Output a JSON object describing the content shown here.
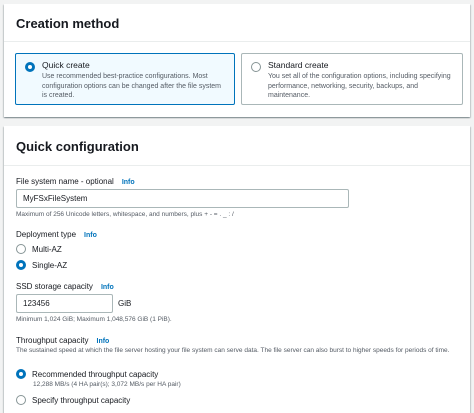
{
  "creation": {
    "title": "Creation method",
    "quick": {
      "label": "Quick create",
      "desc": "Use recommended best-practice configurations. Most configuration options can be changed after the file system is created."
    },
    "standard": {
      "label": "Standard create",
      "desc": "You set all of the configuration options, including specifying performance, networking, security, backups, and maintenance."
    }
  },
  "quick_config": {
    "title": "Quick configuration",
    "info": "Info",
    "fs_name": {
      "label": "File system name - optional",
      "value": "MyFSxFileSystem",
      "hint": "Maximum of 256 Unicode letters, whitespace, and numbers, plus + - = . _ : /"
    },
    "deployment": {
      "label": "Deployment type",
      "options": [
        "Multi-AZ",
        "Single-AZ"
      ],
      "selected": "Single-AZ"
    },
    "storage": {
      "label": "SSD storage capacity",
      "value": "123456",
      "unit": "GiB",
      "hint": "Minimum 1,024 GiB; Maximum 1,048,576 GiB (1 PiB)."
    },
    "throughput": {
      "label": "Throughput capacity",
      "desc": "The sustained speed at which the file server hosting your file system can serve data. The file server can also burst to higher speeds for periods of time.",
      "recommended_label": "Recommended throughput capacity",
      "recommended_desc": "12,288 MB/s (4 HA pair(s); 3,072 MB/s per HA pair)",
      "specify_label": "Specify throughput capacity"
    }
  },
  "colors": {
    "accent": "#0073bb",
    "page_bg": "#f2f3f3",
    "muted_text": "#545b64"
  }
}
